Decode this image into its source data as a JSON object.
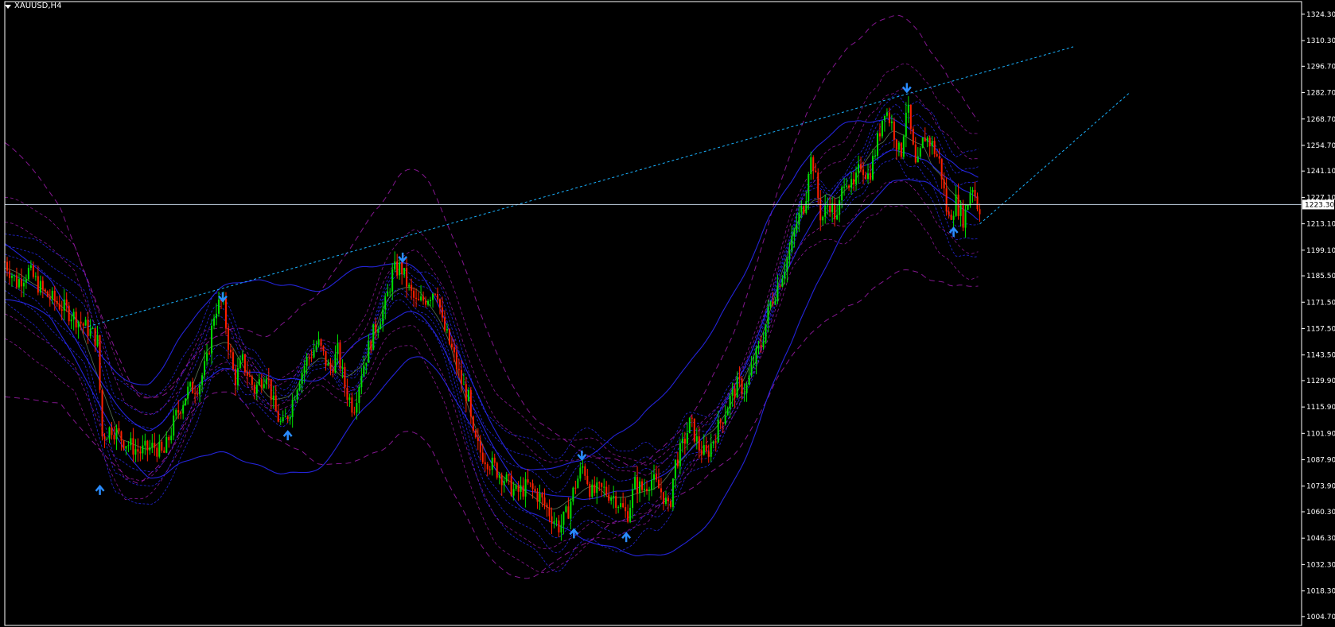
{
  "header": {
    "symbol": "XAUUSD,H4"
  },
  "colors": {
    "background": "#000000",
    "axis": "#ffffff",
    "bull": "#00e000",
    "bear": "#ff2000",
    "trendline": "#1ab2ff",
    "hline": "#c8d8e8",
    "arrow": "#2a8cff",
    "band_blue": "#2a2aff",
    "band_purple": "#9a1aa8",
    "band_green": "#6a8a6a"
  },
  "chart_data": {
    "type": "line",
    "symbol": "XAUUSD",
    "timeframe": "H4",
    "ylim": [
      1000.0,
      1331.0
    ],
    "y_ticks": [
      "1324.30",
      "1310.30",
      "1296.70",
      "1282.70",
      "1268.70",
      "1254.70",
      "1241.10",
      "1227.10",
      "1213.10",
      "1199.10",
      "1185.50",
      "1171.50",
      "1157.50",
      "1143.50",
      "1129.90",
      "1115.90",
      "1101.90",
      "1087.90",
      "1073.90",
      "1060.30",
      "1046.30",
      "1032.30",
      "1018.30",
      "1004.70"
    ],
    "current_price": "1223.30",
    "x_range": [
      0,
      1230
    ],
    "price_path": [
      [
        0,
        1193
      ],
      [
        15,
        1182
      ],
      [
        30,
        1188
      ],
      [
        50,
        1176
      ],
      [
        70,
        1170
      ],
      [
        90,
        1163
      ],
      [
        110,
        1155
      ],
      [
        118,
        1150
      ],
      [
        122,
        1100
      ],
      [
        135,
        1105
      ],
      [
        150,
        1098
      ],
      [
        170,
        1092
      ],
      [
        190,
        1095
      ],
      [
        200,
        1090
      ],
      [
        215,
        1110
      ],
      [
        230,
        1124
      ],
      [
        245,
        1128
      ],
      [
        255,
        1140
      ],
      [
        265,
        1168
      ],
      [
        275,
        1172
      ],
      [
        282,
        1150
      ],
      [
        290,
        1130
      ],
      [
        300,
        1140
      ],
      [
        315,
        1125
      ],
      [
        330,
        1135
      ],
      [
        340,
        1115
      ],
      [
        350,
        1105
      ],
      [
        360,
        1115
      ],
      [
        370,
        1130
      ],
      [
        380,
        1140
      ],
      [
        395,
        1150
      ],
      [
        410,
        1135
      ],
      [
        420,
        1145
      ],
      [
        430,
        1125
      ],
      [
        440,
        1115
      ],
      [
        450,
        1135
      ],
      [
        465,
        1155
      ],
      [
        480,
        1170
      ],
      [
        490,
        1188
      ],
      [
        500,
        1190
      ],
      [
        510,
        1178
      ],
      [
        520,
        1170
      ],
      [
        535,
        1175
      ],
      [
        545,
        1180
      ],
      [
        552,
        1160
      ],
      [
        565,
        1145
      ],
      [
        575,
        1130
      ],
      [
        585,
        1120
      ],
      [
        590,
        1100
      ],
      [
        600,
        1092
      ],
      [
        615,
        1085
      ],
      [
        630,
        1078
      ],
      [
        645,
        1070
      ],
      [
        660,
        1074
      ],
      [
        675,
        1068
      ],
      [
        690,
        1058
      ],
      [
        700,
        1052
      ],
      [
        710,
        1060
      ],
      [
        720,
        1075
      ],
      [
        730,
        1085
      ],
      [
        740,
        1070
      ],
      [
        755,
        1072
      ],
      [
        770,
        1068
      ],
      [
        785,
        1058
      ],
      [
        795,
        1075
      ],
      [
        805,
        1072
      ],
      [
        815,
        1078
      ],
      [
        830,
        1070
      ],
      [
        838,
        1060
      ],
      [
        845,
        1085
      ],
      [
        855,
        1095
      ],
      [
        865,
        1108
      ],
      [
        875,
        1095
      ],
      [
        885,
        1090
      ],
      [
        895,
        1100
      ],
      [
        905,
        1110
      ],
      [
        915,
        1120
      ],
      [
        925,
        1128
      ],
      [
        935,
        1125
      ],
      [
        945,
        1140
      ],
      [
        955,
        1150
      ],
      [
        965,
        1170
      ],
      [
        975,
        1180
      ],
      [
        990,
        1198
      ],
      [
        1000,
        1215
      ],
      [
        1010,
        1225
      ],
      [
        1015,
        1248
      ],
      [
        1020,
        1245
      ],
      [
        1030,
        1215
      ],
      [
        1040,
        1225
      ],
      [
        1050,
        1215
      ],
      [
        1060,
        1240
      ],
      [
        1070,
        1230
      ],
      [
        1080,
        1245
      ],
      [
        1090,
        1238
      ],
      [
        1100,
        1255
      ],
      [
        1110,
        1275
      ],
      [
        1120,
        1265
      ],
      [
        1130,
        1248
      ],
      [
        1138,
        1278
      ],
      [
        1145,
        1255
      ],
      [
        1150,
        1240
      ],
      [
        1160,
        1260
      ],
      [
        1170,
        1255
      ],
      [
        1180,
        1245
      ],
      [
        1190,
        1215
      ],
      [
        1200,
        1225
      ],
      [
        1210,
        1215
      ],
      [
        1220,
        1235
      ],
      [
        1228,
        1222
      ]
    ],
    "trendlines": [
      {
        "from": [
          100,
          1158
        ],
        "to": [
          1348,
          1307
        ]
      },
      {
        "from": [
          1230,
          1213
        ],
        "to": [
          1420,
          1283
        ]
      }
    ],
    "arrows": [
      {
        "x": 120,
        "price": 1073,
        "dir": "up"
      },
      {
        "x": 275,
        "price": 1173,
        "dir": "down"
      },
      {
        "x": 357,
        "price": 1102,
        "dir": "up"
      },
      {
        "x": 502,
        "price": 1194,
        "dir": "down"
      },
      {
        "x": 718,
        "price": 1050,
        "dir": "up"
      },
      {
        "x": 728,
        "price": 1089,
        "dir": "down"
      },
      {
        "x": 784,
        "price": 1048,
        "dir": "up"
      },
      {
        "x": 1138,
        "price": 1284,
        "dir": "down"
      },
      {
        "x": 1197,
        "price": 1210,
        "dir": "up"
      }
    ]
  }
}
